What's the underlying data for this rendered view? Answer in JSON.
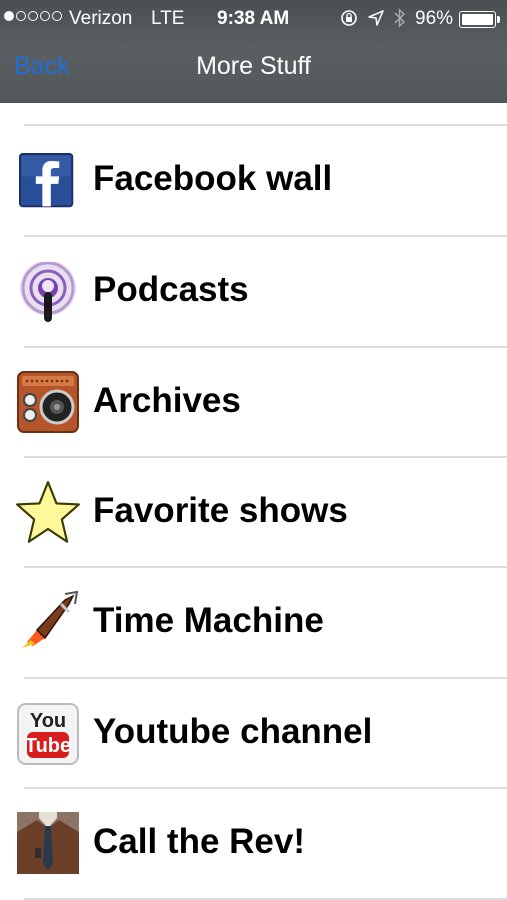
{
  "status_bar": {
    "carrier": "Verizon",
    "network": "LTE",
    "time": "9:38 AM",
    "battery_percent": "96%",
    "signal_bars_filled": 1,
    "signal_bars_total": 5,
    "icons": [
      "orientation-lock-icon",
      "location-arrow-icon",
      "bluetooth-icon",
      "battery-icon"
    ]
  },
  "nav_bar": {
    "back_label": "Back",
    "title": "More Stuff",
    "back_color": "#1e6fd9"
  },
  "menu": {
    "items": [
      {
        "label": "Facebook wall",
        "icon": "facebook-icon"
      },
      {
        "label": "Podcasts",
        "icon": "podcasts-icon"
      },
      {
        "label": "Archives",
        "icon": "radio-archive-icon"
      },
      {
        "label": "Favorite shows",
        "icon": "star-icon"
      },
      {
        "label": "Time Machine",
        "icon": "rocket-icon"
      },
      {
        "label": "Youtube channel",
        "icon": "youtube-icon"
      },
      {
        "label": "Call the Rev!",
        "icon": "rev-photo-icon"
      }
    ]
  }
}
